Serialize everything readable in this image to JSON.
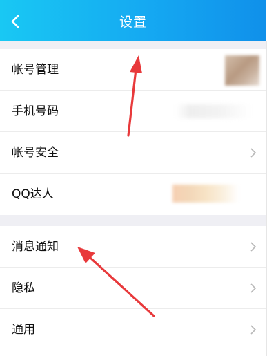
{
  "header": {
    "title": "设置",
    "back_icon": "chevron-left-icon",
    "background": "#15a9f2"
  },
  "section_account": [
    {
      "label": "帐号管理",
      "trailing": "avatar"
    },
    {
      "label": "手机号码",
      "trailing": "masked-phone"
    },
    {
      "label": "帐号安全",
      "trailing": "chevron"
    },
    {
      "label": "QQ达人",
      "trailing": "badges"
    }
  ],
  "section_settings": [
    {
      "label": "消息通知",
      "trailing": "chevron"
    },
    {
      "label": "隐私",
      "trailing": "chevron"
    },
    {
      "label": "通用",
      "trailing": "chevron"
    }
  ],
  "annotation_color": "#e8393b"
}
